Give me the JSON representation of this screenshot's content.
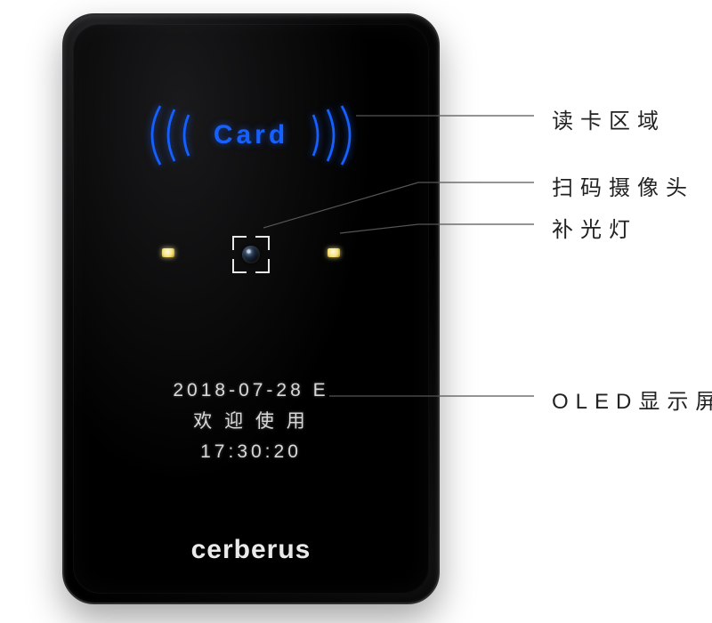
{
  "device": {
    "brand": "cerberus",
    "card_label": "Card"
  },
  "oled": {
    "date": "2018-07-28 E",
    "greeting": "欢 迎 使 用",
    "time": "17:30:20"
  },
  "callouts": {
    "card_area": "读卡区域",
    "camera": "扫码摄像头",
    "fill_light": "补光灯",
    "oled": "OLED显示屏"
  }
}
